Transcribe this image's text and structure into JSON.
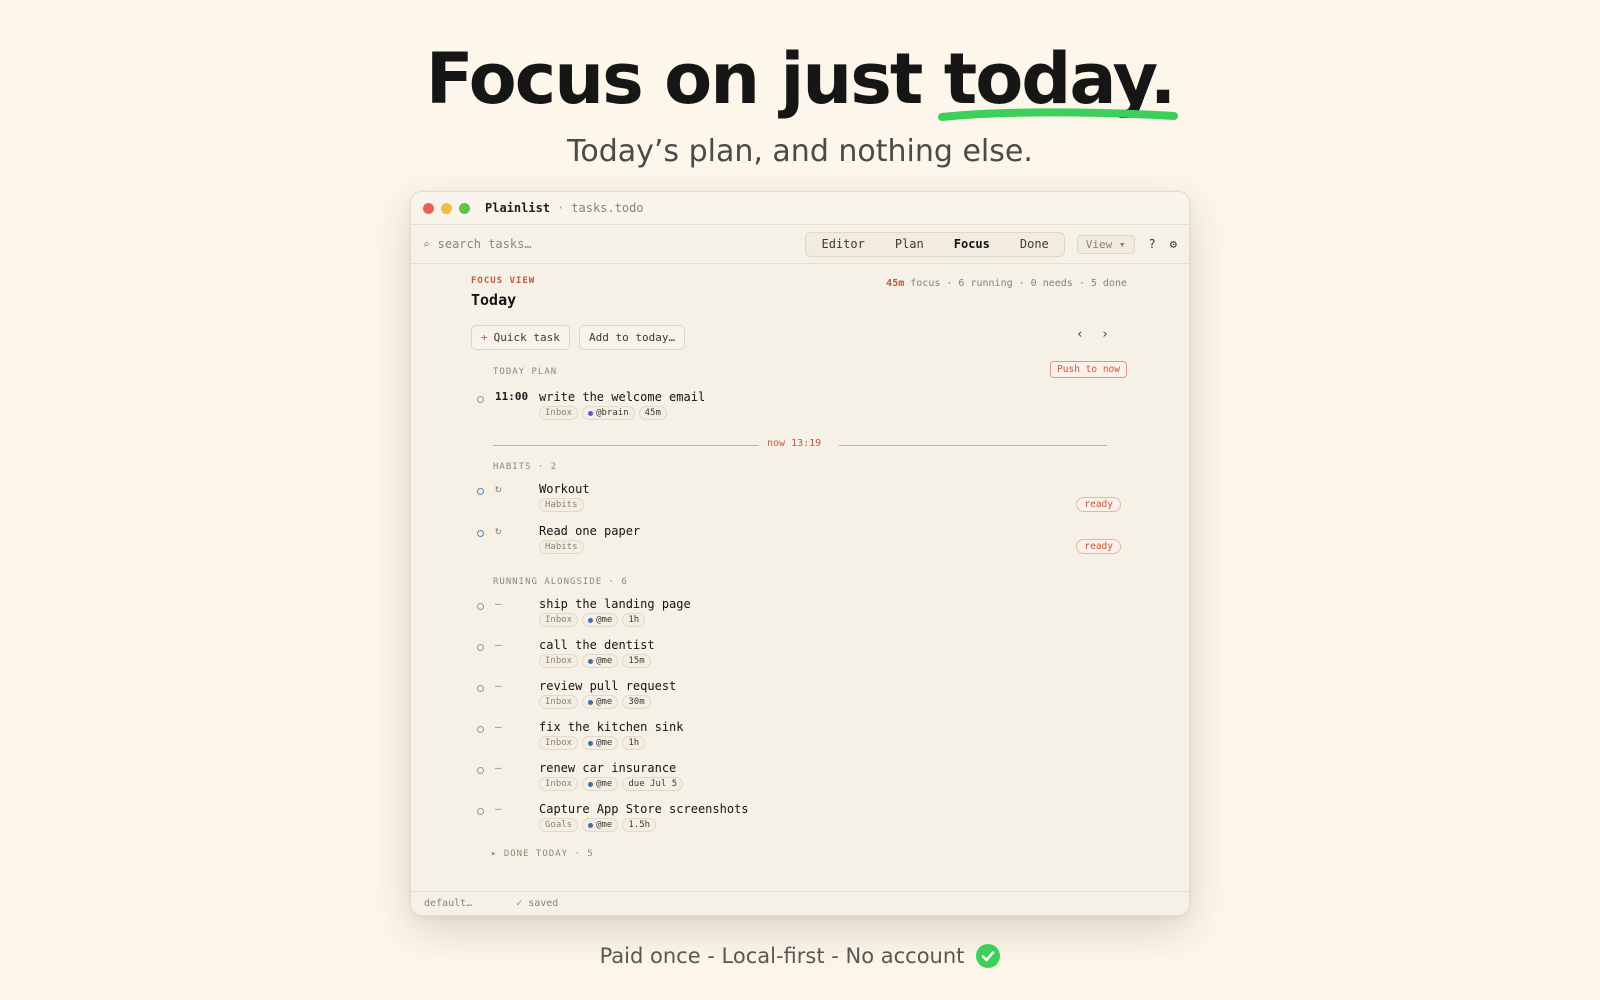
{
  "hero": {
    "title_prefix": "Focus on just ",
    "title_accent": "today.",
    "subtitle": "Today’s plan, and nothing else.",
    "accent_color": "#3ccf5a"
  },
  "window": {
    "app_name": "Plainlist",
    "separator": "·",
    "filename": "tasks.todo"
  },
  "toolbar": {
    "search_placeholder": "search tasks…",
    "search_icon": "search-icon",
    "tabs": [
      {
        "label": "Editor",
        "active": false
      },
      {
        "label": "Plan",
        "active": false
      },
      {
        "label": "Focus",
        "active": true
      },
      {
        "label": "Done",
        "active": false
      }
    ],
    "view_label": "View ▾",
    "help_label": "?",
    "settings_icon": "⚙"
  },
  "focus": {
    "section_label": "FOCUS VIEW",
    "title": "Today",
    "stats": {
      "focus": "45m",
      "rest": " focus · 6 running · 0 needs · 5 done"
    },
    "quick_task_plus": "+",
    "quick_task_label": "Quick task",
    "add_today_label": "Add to today…",
    "prev_arrow": "‹",
    "next_arrow": "›"
  },
  "today_plan": {
    "label": "TODAY PLAN",
    "push_label": "Push to now",
    "task": {
      "time": "11:00",
      "title": "write the welcome email",
      "tags": [
        "Inbox",
        "@brain",
        "45m"
      ]
    }
  },
  "now_marker": "now 13:19",
  "habits": {
    "label": "HABITS · 2",
    "items": [
      {
        "marker": "↻",
        "title": "Workout",
        "tag": "Habits",
        "status": "ready"
      },
      {
        "marker": "↻",
        "title": "Read one paper",
        "tag": "Habits",
        "status": "ready"
      }
    ]
  },
  "running": {
    "label": "RUNNING ALONGSIDE · 6",
    "items": [
      {
        "marker": "–",
        "title": "ship the landing page",
        "list": "Inbox",
        "owner": "@me",
        "meta": "1h"
      },
      {
        "marker": "–",
        "title": "call the dentist",
        "list": "Inbox",
        "owner": "@me",
        "meta": "15m"
      },
      {
        "marker": "–",
        "title": "review pull request",
        "list": "Inbox",
        "owner": "@me",
        "meta": "30m"
      },
      {
        "marker": "–",
        "title": "fix the kitchen sink",
        "list": "Inbox",
        "owner": "@me",
        "meta": "1h"
      },
      {
        "marker": "–",
        "title": "renew car insurance",
        "list": "Inbox",
        "owner": "@me",
        "meta": "due Jul 5"
      },
      {
        "marker": "–",
        "title": "Capture App Store screenshots",
        "list": "Goals",
        "owner": "@me",
        "meta": "1.5h"
      }
    ]
  },
  "done_today": "▸ DONE TODAY · 5",
  "statusbar": {
    "profile": "default…",
    "saved": "✓ saved"
  },
  "footer": {
    "text": "Paid once - Local-first - No account",
    "icon": "check-circle-icon"
  }
}
